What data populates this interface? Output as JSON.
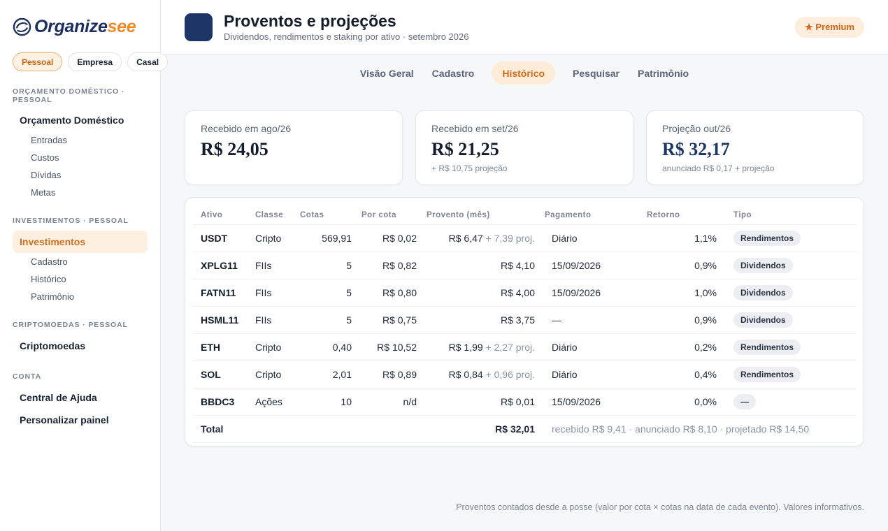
{
  "brand": {
    "name_part1": "Organize",
    "name_part2": "see"
  },
  "contexts": [
    {
      "label": "Pessoal",
      "active": true
    },
    {
      "label": "Empresa",
      "active": false
    },
    {
      "label": "Casal",
      "active": false
    }
  ],
  "sidebar": {
    "section_orcamento": "ORÇAMENTO DOMÉSTICO · PESSOAL",
    "orcamento_main": "Orçamento Doméstico",
    "orcamento_items": [
      "Entradas",
      "Custos",
      "Dívidas",
      "Metas"
    ],
    "section_investimentos": "INVESTIMENTOS · PESSOAL",
    "investimentos_main": "Investimentos",
    "investimentos_items": [
      "Cadastro",
      "Histórico",
      "Patrimônio"
    ],
    "section_cripto": "CRIPTOMOEDAS · PESSOAL",
    "cripto_main": "Criptomoedas",
    "section_conta": "CONTA",
    "conta_items": [
      "Central de Ajuda",
      "Personalizar painel"
    ]
  },
  "header": {
    "title": "Proventos e projeções",
    "subtitle": "Dividendos, rendimentos e staking por ativo · setembro 2026",
    "premium_label": "★ Premium"
  },
  "tabs": [
    "Visão Geral",
    "Cadastro",
    "Histórico",
    "Pesquisar",
    "Patrimônio"
  ],
  "active_tab": "Histórico",
  "cards": [
    {
      "label": "Recebido em ago/26",
      "value": "R$ 24,05",
      "note": ""
    },
    {
      "label": "Recebido em set/26",
      "value": "R$ 21,25",
      "note": "+ R$ 10,75 projeção"
    },
    {
      "label": "Projeção out/26",
      "value": "R$ 32,17",
      "note": "anunciado R$ 0,17 + projeção"
    }
  ],
  "table": {
    "headers": [
      "Ativo",
      "Classe",
      "Cotas",
      "Por cota",
      "Provento (mês)",
      "Pagamento",
      "Retorno",
      "Tipo"
    ],
    "rows": [
      {
        "ativo": "USDT",
        "classe": "Cripto",
        "cotas": "569,91",
        "por_cota": "R$ 0,02",
        "provento": "R$ 6,47",
        "proj": " + 7,39 proj.",
        "pagamento": "Diário",
        "retorno": "1,1%",
        "tipo": "Rendimentos"
      },
      {
        "ativo": "XPLG11",
        "classe": "FIIs",
        "cotas": "5",
        "por_cota": "R$ 0,82",
        "provento": "R$ 4,10",
        "proj": "",
        "pagamento": "15/09/2026",
        "retorno": "0,9%",
        "tipo": "Dividendos"
      },
      {
        "ativo": "FATN11",
        "classe": "FIIs",
        "cotas": "5",
        "por_cota": "R$ 0,80",
        "provento": "R$ 4,00",
        "proj": "",
        "pagamento": "15/09/2026",
        "retorno": "1,0%",
        "tipo": "Dividendos"
      },
      {
        "ativo": "HSML11",
        "classe": "FIIs",
        "cotas": "5",
        "por_cota": "R$ 0,75",
        "provento": "R$ 3,75",
        "proj": "",
        "pagamento": "—",
        "retorno": "0,9%",
        "tipo": "Dividendos"
      },
      {
        "ativo": "ETH",
        "classe": "Cripto",
        "cotas": "0,40",
        "por_cota": "R$ 10,52",
        "provento": "R$ 1,99",
        "proj": " + 2,27 proj.",
        "pagamento": "Diário",
        "retorno": "0,2%",
        "tipo": "Rendimentos"
      },
      {
        "ativo": "SOL",
        "classe": "Cripto",
        "cotas": "2,01",
        "por_cota": "R$ 0,89",
        "provento": "R$ 0,84",
        "proj": " + 0,96 proj.",
        "pagamento": "Diário",
        "retorno": "0,4%",
        "tipo": "Rendimentos"
      },
      {
        "ativo": "BBDC3",
        "classe": "Ações",
        "cotas": "10",
        "por_cota": "n/d",
        "provento": "R$ 0,01",
        "proj": "",
        "pagamento": "15/09/2026",
        "retorno": "0,0%",
        "tipo": "—"
      }
    ],
    "total_label": "Total",
    "total_value": "R$ 32,01",
    "total_note": "recebido R$ 9,41 · anunciado R$ 8,10 · projetado R$ 14,50"
  },
  "footnote": "Proventos contados desde a posse (valor por cota × cotas na data de cada evento). Valores informativos."
}
